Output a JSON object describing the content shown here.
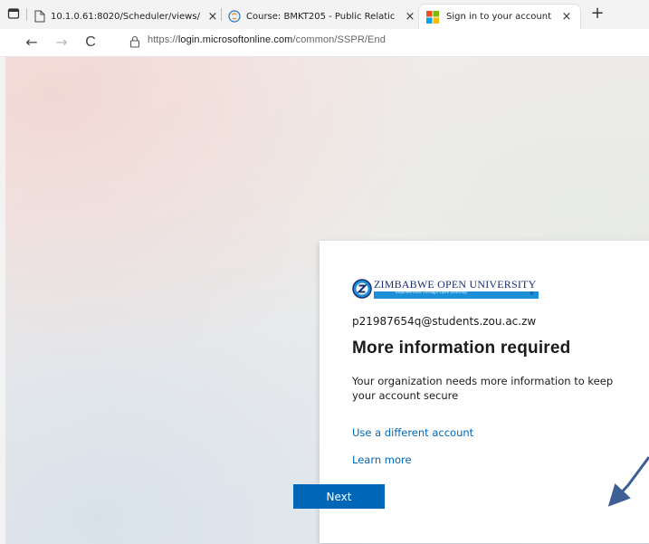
{
  "browser": {
    "tabs": [
      {
        "label": "10.1.0.61:8020/Scheduler/views/",
        "close": "×"
      },
      {
        "label": "Course: BMKT205 - Public Relatic",
        "close": "×"
      },
      {
        "label": "Sign in to your account",
        "close": "×"
      }
    ],
    "new_tab": "+",
    "nav": {
      "back": "←",
      "forward": "→",
      "refresh": "C"
    },
    "url_prefix": "https://",
    "url_host": "login.microsoftonline.com",
    "url_path": "/common/SSPR/End"
  },
  "card": {
    "logo_text": "ZIMBABWE OPEN UNIVERSITY",
    "logo_tagline": "Empowerment Through Open Learning",
    "email": "p21987654q@students.zou.ac.zw",
    "title": "More information required",
    "description": "Your organization needs more information to keep your account secure",
    "link_different_account": "Use a different account",
    "link_learn_more": "Learn more",
    "next_label": "Next"
  },
  "colors": {
    "accent": "#0067b8",
    "logo_blue": "#1c8fd6",
    "logo_navy": "#1b2f73",
    "annotation_arrow": "#3e5f93"
  }
}
